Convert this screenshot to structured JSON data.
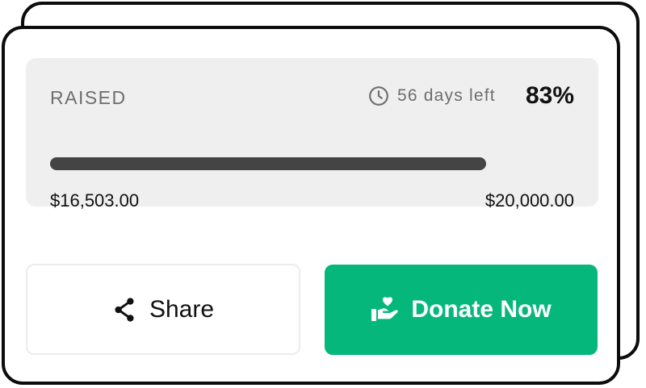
{
  "progress": {
    "label": "RAISED",
    "days_left": "56 days left",
    "percent_text": "83%",
    "fraction": 0.83,
    "raised": "$16,503.00",
    "goal": "$20,000.00",
    "bar_color": "#444444",
    "panel_color": "#efefef"
  },
  "actions": {
    "share_label": "Share",
    "share_icon": "share-icon",
    "donate_label": "Donate Now",
    "donate_icon": "donate-hand-heart-icon",
    "donate_color": "#06b77b"
  }
}
